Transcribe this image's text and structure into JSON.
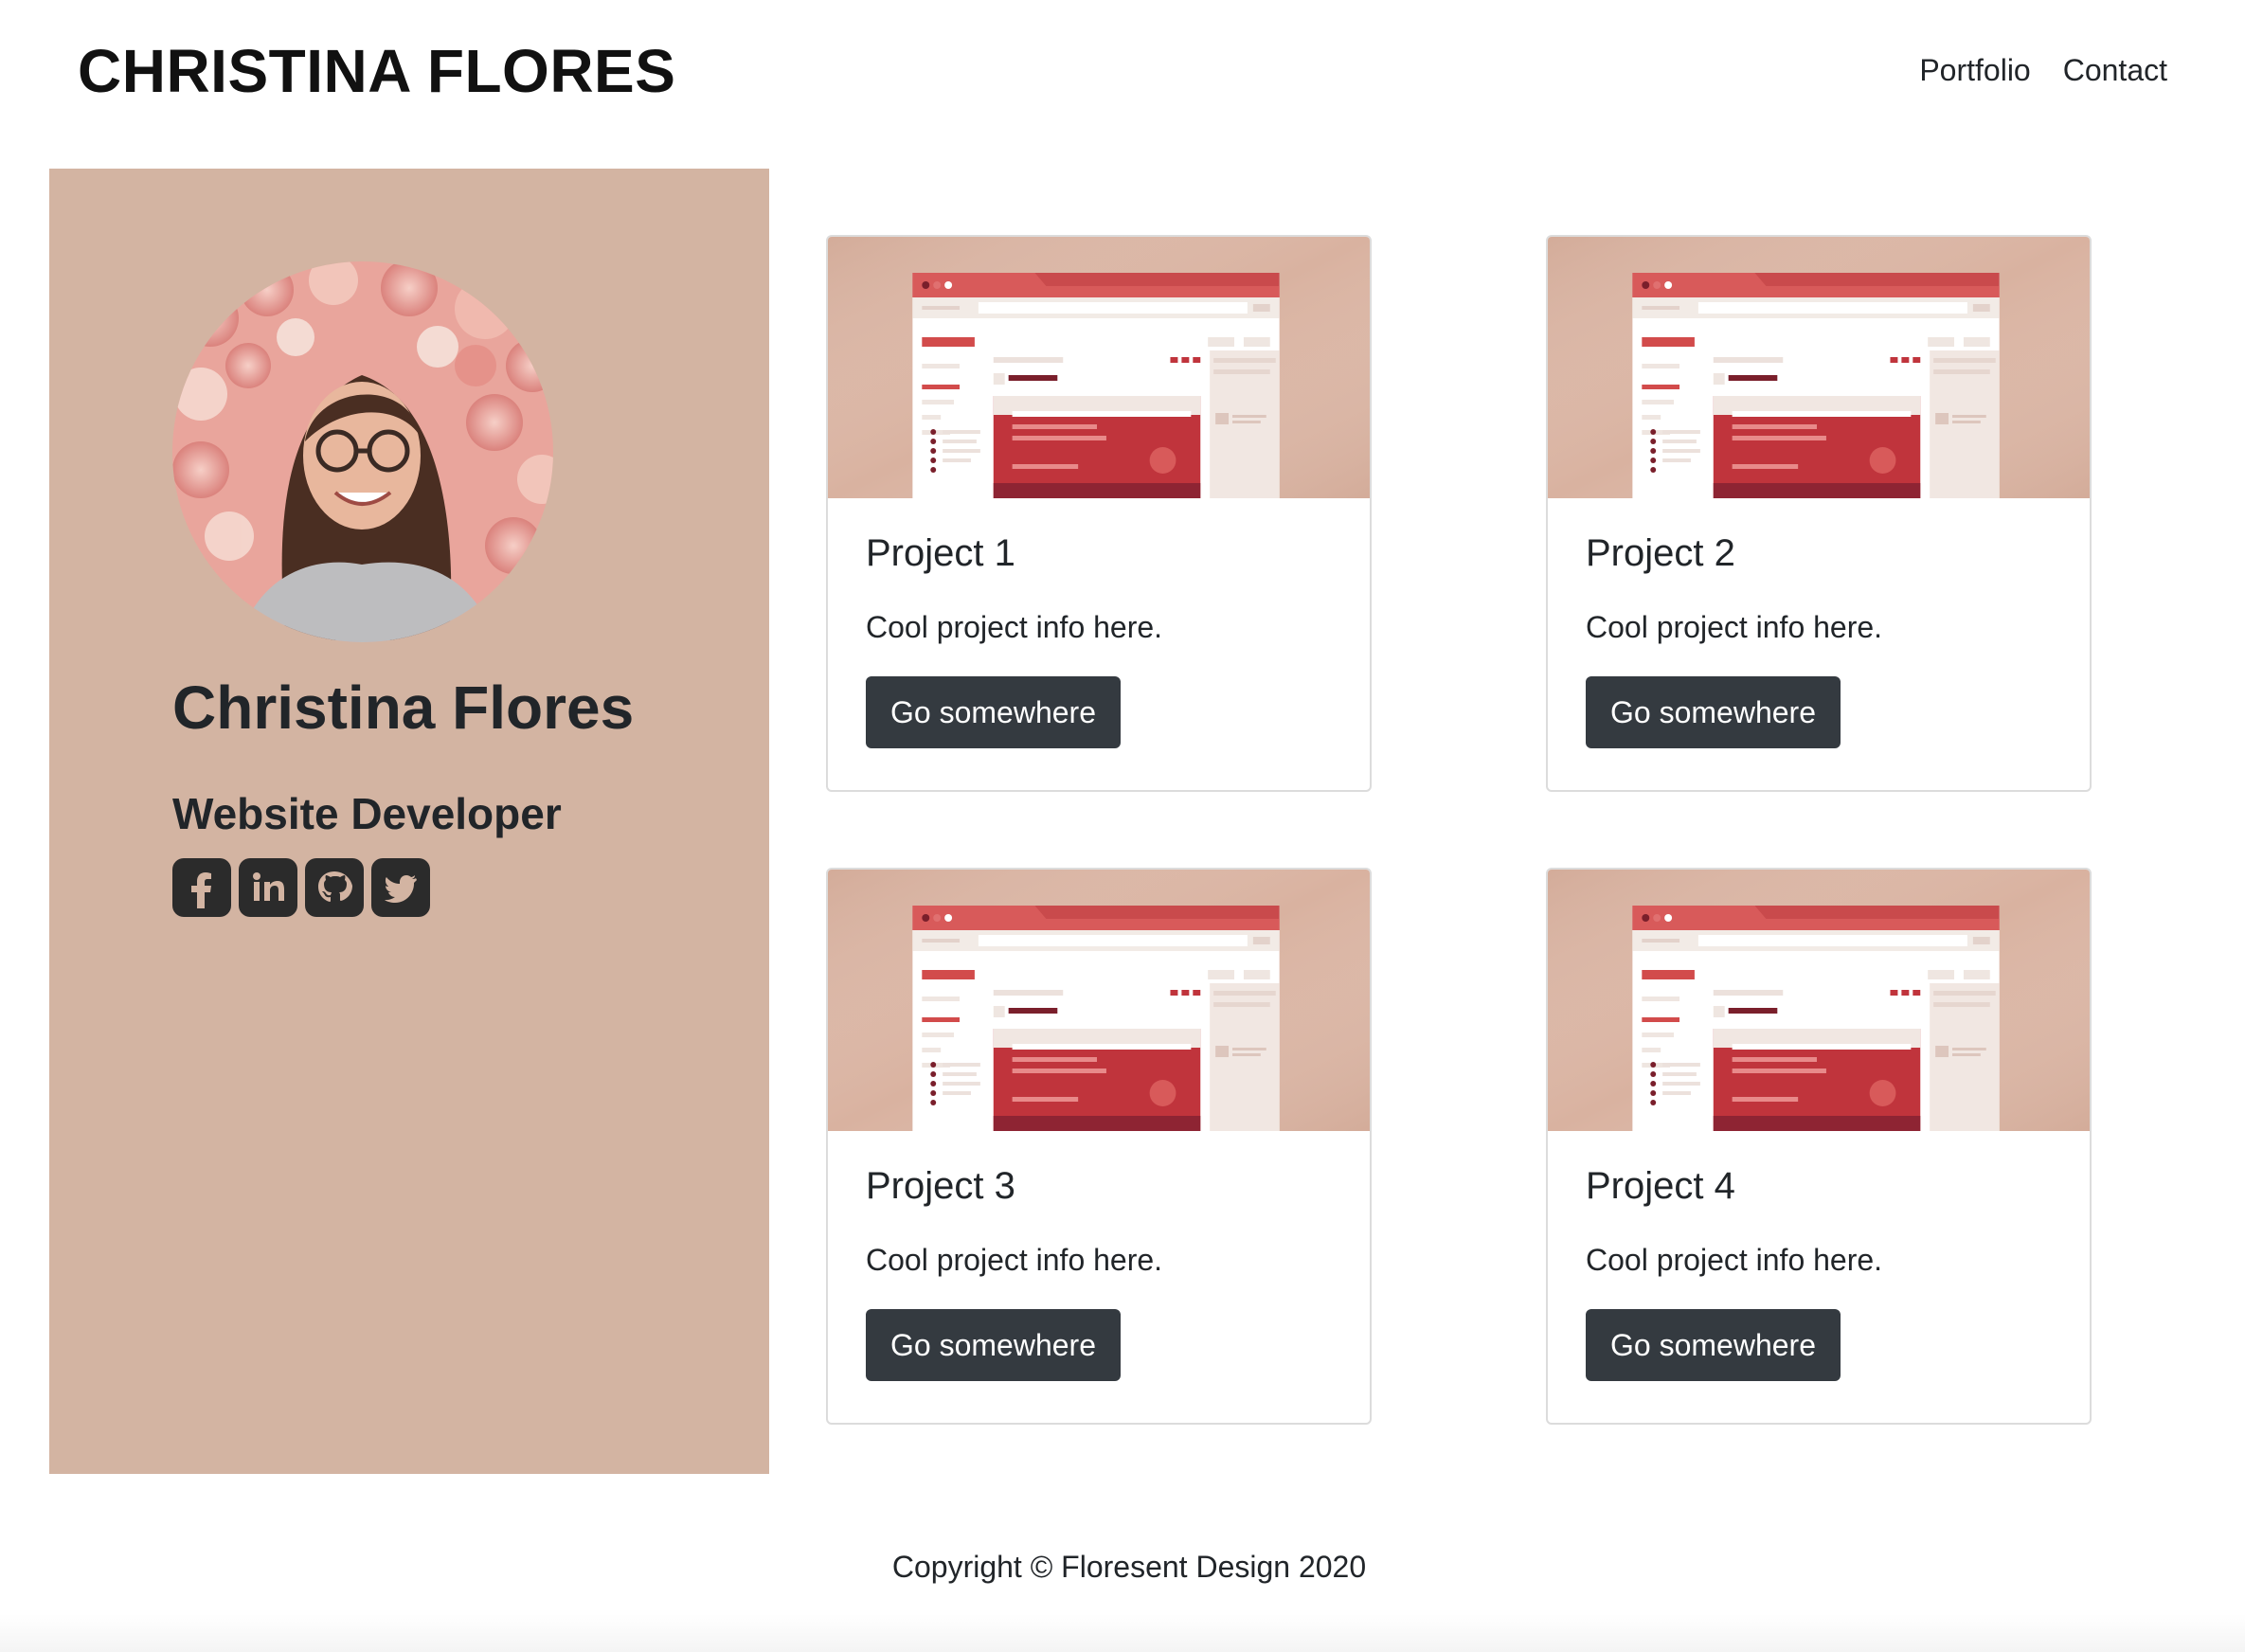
{
  "header": {
    "title": "CHRISTINA FLORES",
    "nav": [
      {
        "label": "Portfolio"
      },
      {
        "label": "Contact"
      }
    ]
  },
  "profile": {
    "name": "Christina Flores",
    "role": "Website Developer",
    "social": [
      {
        "icon": "facebook-icon"
      },
      {
        "icon": "linkedin-icon"
      },
      {
        "icon": "github-icon"
      },
      {
        "icon": "twitter-icon"
      }
    ]
  },
  "projects": [
    {
      "title": "Project 1",
      "text": "Cool project info here.",
      "button": "Go somewhere"
    },
    {
      "title": "Project 2",
      "text": "Cool project info here.",
      "button": "Go somewhere"
    },
    {
      "title": "Project 3",
      "text": "Cool project info here.",
      "button": "Go somewhere"
    },
    {
      "title": "Project 4",
      "text": "Cool project info here.",
      "button": "Go somewhere"
    }
  ],
  "footer": {
    "copyright": "Copyright © Floresent Design 2020"
  },
  "colors": {
    "sidebar": "#d3b4a2",
    "button": "#343a40",
    "accent": "#c0343c"
  }
}
